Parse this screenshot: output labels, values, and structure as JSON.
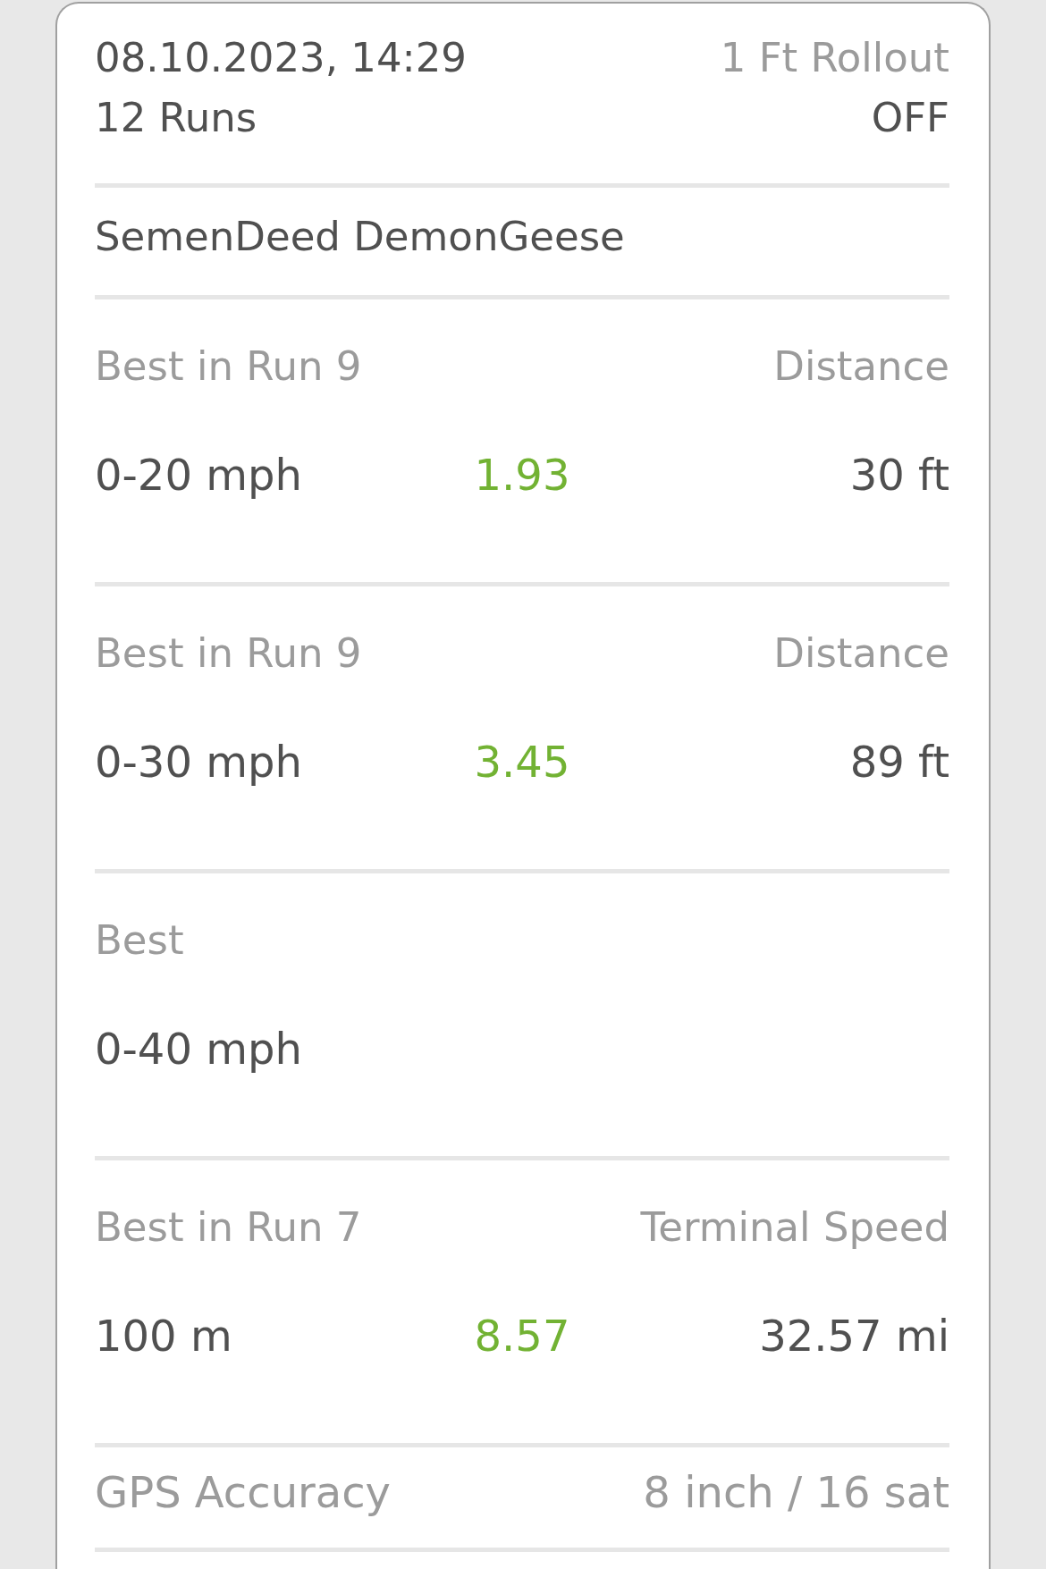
{
  "header": {
    "date_time": "08.10.2023, 14:29",
    "runs": "12 Runs",
    "rollout_label": "1 Ft Rollout",
    "rollout_value": "OFF"
  },
  "vehicle": {
    "name": "SemenDeed DemonGeese"
  },
  "results": [
    {
      "label": "Best in Run 9",
      "measure_label": "Distance",
      "range": "0-20 mph",
      "time": "1.93",
      "measure_value": "30 ft"
    },
    {
      "label": "Best in Run 9",
      "measure_label": "Distance",
      "range": "0-30 mph",
      "time": "3.45",
      "measure_value": "89 ft"
    },
    {
      "label": "Best",
      "range": "0-40 mph"
    },
    {
      "label": "Best in Run 7",
      "measure_label": "Terminal Speed",
      "range": "100 m",
      "time": "8.57",
      "measure_value": "32.57 mi"
    }
  ],
  "gps": {
    "label": "GPS Accuracy",
    "value": "8 inch / 16 sat"
  }
}
